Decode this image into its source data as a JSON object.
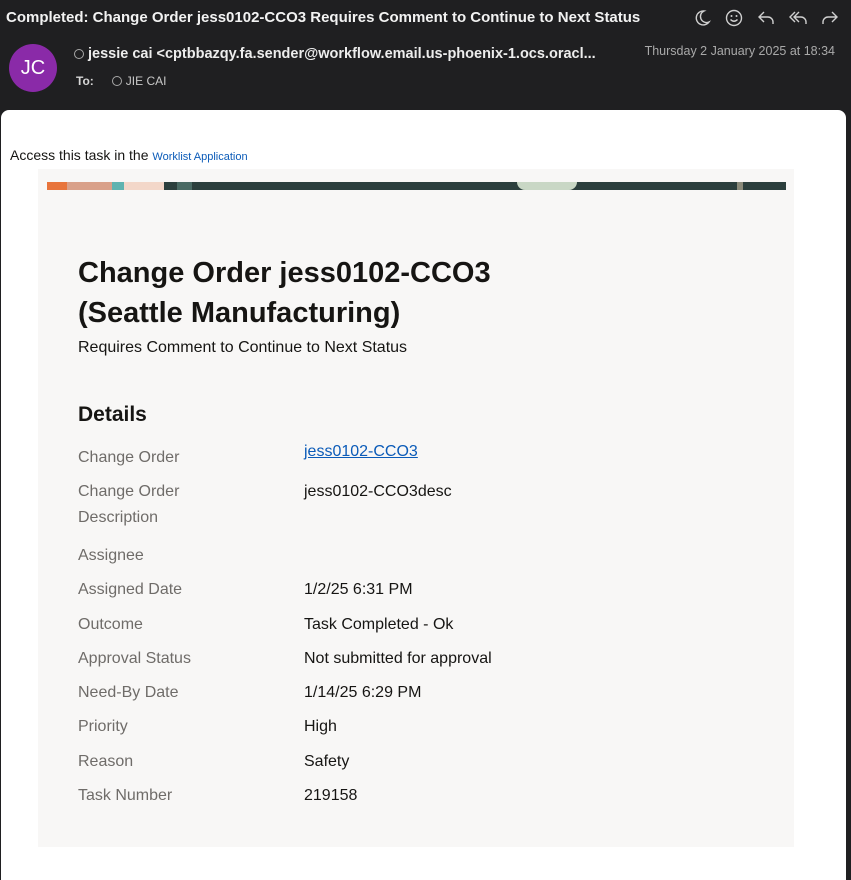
{
  "email": {
    "subject": "Completed: Change Order jess0102-CCO3 Requires Comment to Continue to Next Status",
    "avatar_initials": "JC",
    "from": "jessie cai <cptbbazqy.fa.sender@workflow.email.us-phoenix-1.ocs.oracl...",
    "to_label": "To:",
    "to_name": "JIE CAI",
    "date": "Thursday 2 January 2025 at 18:34"
  },
  "toolbar_icons": [
    "moon-icon",
    "smiley-icon",
    "reply-icon",
    "reply-all-icon",
    "forward-icon"
  ],
  "body": {
    "access_text": "Access this task in the ",
    "access_link": "Worklist Application",
    "title_line1": "Change Order jess0102-CCO3",
    "title_line2": "(Seattle Manufacturing)",
    "subtitle": "Requires Comment to Continue to Next Status",
    "details_heading": "Details",
    "details": [
      {
        "label": "Change Order",
        "value": "jess0102-CCO3"
      },
      {
        "label": "Change Order Description",
        "value": "jess0102-CCO3desc"
      },
      {
        "label": "Assignee",
        "value": ""
      },
      {
        "label": "Assigned Date",
        "value": "1/2/25 6:31 PM"
      },
      {
        "label": "Outcome",
        "value": "Task Completed - Ok"
      },
      {
        "label": "Approval Status",
        "value": "Not submitted for approval"
      },
      {
        "label": "Need-By Date",
        "value": "1/14/25 6:29 PM"
      },
      {
        "label": "Priority",
        "value": "High"
      },
      {
        "label": "Reason",
        "value": "Safety"
      },
      {
        "label": "Task Number",
        "value": "219158"
      }
    ]
  },
  "colors": {
    "background": "#1f1f21",
    "avatar": "#8a2aa8",
    "link": "#0b5bb8",
    "card": "#f8f7f6"
  }
}
